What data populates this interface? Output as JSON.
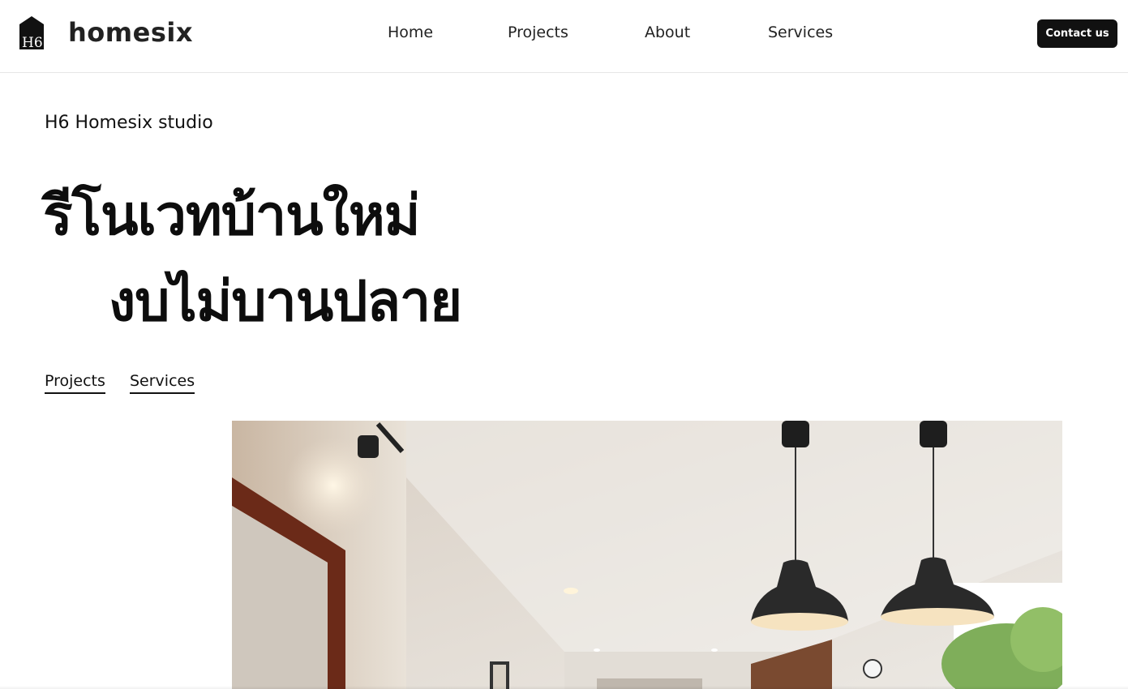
{
  "header": {
    "logo_mark_text": "H6",
    "logo_text": "homesix",
    "nav": {
      "home": "Home",
      "projects": "Projects",
      "about": "About",
      "services": "Services"
    },
    "contact_label": "Contact us"
  },
  "hero": {
    "studio_name": "H6 Homesix studio",
    "headline_line1": "รีโนเวทบ้านใหม่",
    "headline_line2": "งบไม่บานปลาย",
    "links": {
      "projects": "Projects",
      "services": "Services"
    }
  },
  "colors": {
    "primary": "#111111",
    "button_text": "#ffffff",
    "header_border": "#e6e6e6"
  }
}
